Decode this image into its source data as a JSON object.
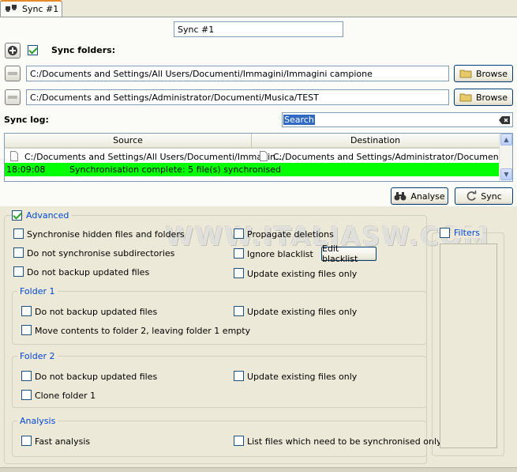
{
  "tab": {
    "label": "Sync #1",
    "icon": "sync-pair-icon"
  },
  "sync_name": {
    "value": "Sync #1"
  },
  "sync_folders": {
    "label": "Sync folders:",
    "checked": true,
    "folders": [
      {
        "path": "C:/Documents and Settings/All Users/Documenti/Immagini/Immagini campione",
        "browse_label": "Browse"
      },
      {
        "path": "C:/Documents and Settings/Administrator/Documenti/Musica/TEST",
        "browse_label": "Browse"
      }
    ]
  },
  "sync_log": {
    "label": "Sync log:",
    "search_value": "Search",
    "columns": [
      "Source",
      "Destination"
    ],
    "rows": [
      {
        "source": "C:/Documents and Settings/All Users/Documenti/Immagin...",
        "destination": "C:/Documents and Settings/Administrator/Documenti/Mu..."
      }
    ],
    "status": {
      "time": "18:09:08",
      "message": "Synchronisation complete: 5 file(s) synchronised",
      "color": "#00ff00"
    }
  },
  "actions": {
    "analyse_label": "Analyse",
    "sync_label": "Sync"
  },
  "advanced": {
    "label": "Advanced",
    "checked": true,
    "options": {
      "sync_hidden": "Synchronise hidden files and folders",
      "no_subdirs": "Do not synchronise subdirectories",
      "no_backup": "Do not backup updated files",
      "propagate_deletions": "Propagate deletions",
      "ignore_blacklist": "Ignore blacklist",
      "edit_blacklist": "Edit blacklist",
      "update_existing": "Update existing files only"
    },
    "folder1": {
      "title": "Folder 1",
      "no_backup": "Do not backup updated files",
      "update_existing": "Update existing files only",
      "move_contents": "Move contents to folder 2, leaving folder 1 empty"
    },
    "folder2": {
      "title": "Folder 2",
      "no_backup": "Do not backup updated files",
      "update_existing": "Update existing files only",
      "clone": "Clone folder 1"
    },
    "analysis": {
      "title": "Analysis",
      "fast": "Fast analysis",
      "list_files": "List files which need to be synchronised only"
    }
  },
  "filters": {
    "label": "Filters",
    "checked": false
  },
  "watermark": "WWW.ITALIASW.COM"
}
